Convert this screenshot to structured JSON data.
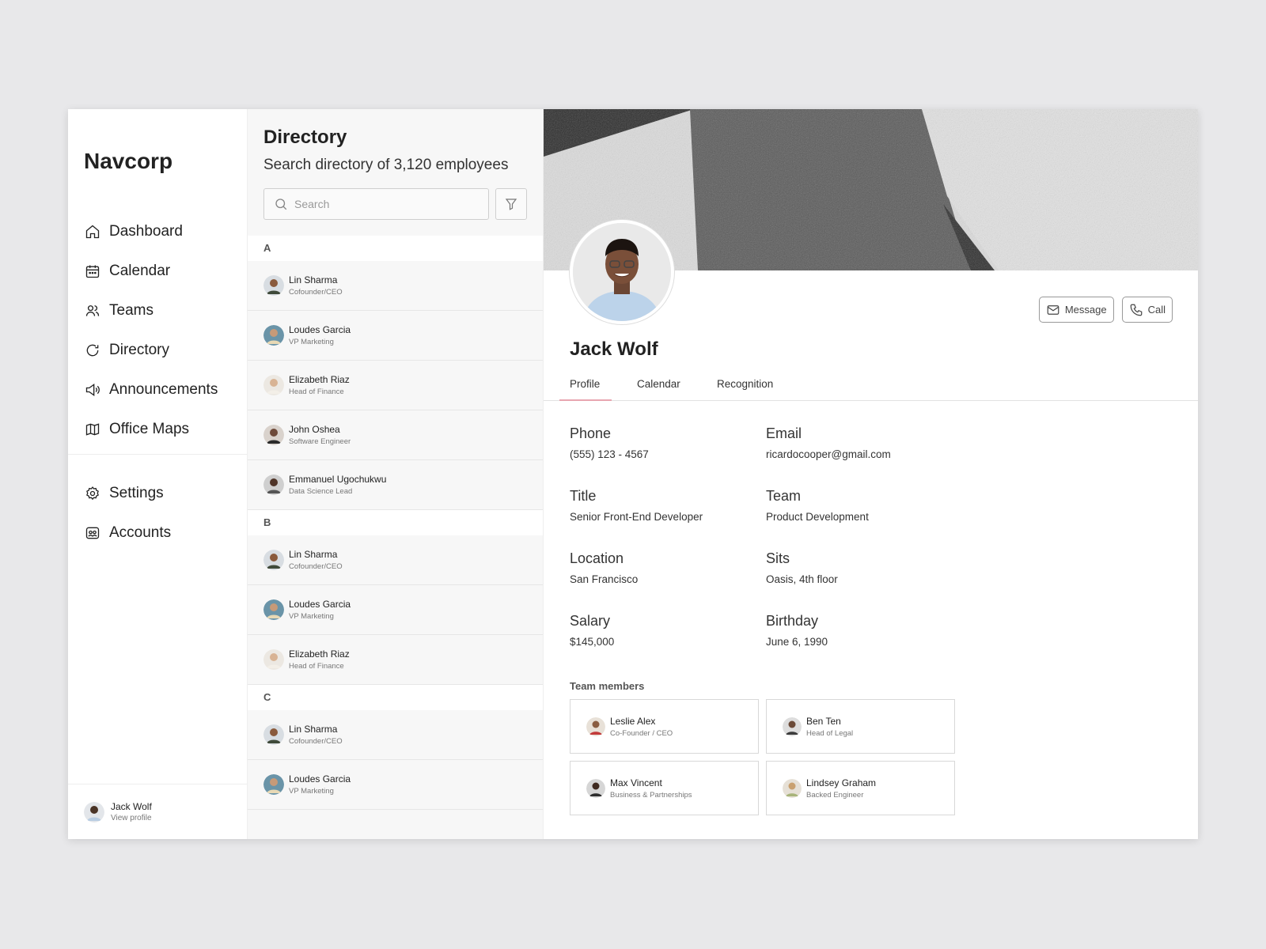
{
  "app": {
    "name": "Navcorp"
  },
  "sidebar": {
    "items": [
      {
        "label": "Dashboard",
        "icon": "home-icon"
      },
      {
        "label": "Calendar",
        "icon": "calendar-icon"
      },
      {
        "label": "Teams",
        "icon": "users-icon"
      },
      {
        "label": "Directory",
        "icon": "directory-icon"
      },
      {
        "label": "Announcements",
        "icon": "megaphone-icon"
      },
      {
        "label": "Office Maps",
        "icon": "map-icon"
      }
    ],
    "secondary": [
      {
        "label": "Settings",
        "icon": "gear-icon"
      },
      {
        "label": "Accounts",
        "icon": "accounts-icon"
      }
    ],
    "user": {
      "name": "Jack Wolf",
      "link": "View profile"
    }
  },
  "directory": {
    "title": "Directory",
    "subtitle": "Search directory of 3,120 employees",
    "search_placeholder": "Search",
    "groups": [
      {
        "letter": "A",
        "people": [
          {
            "name": "Lin Sharma",
            "role": "Cofounder/CEO"
          },
          {
            "name": "Loudes Garcia",
            "role": "VP Marketing"
          },
          {
            "name": "Elizabeth Riaz",
            "role": "Head of Finance"
          },
          {
            "name": "John Oshea",
            "role": "Software Engineer"
          },
          {
            "name": "Emmanuel Ugochukwu",
            "role": "Data Science Lead"
          }
        ]
      },
      {
        "letter": "B",
        "people": [
          {
            "name": "Lin Sharma",
            "role": "Cofounder/CEO"
          },
          {
            "name": "Loudes Garcia",
            "role": "VP Marketing"
          },
          {
            "name": "Elizabeth Riaz",
            "role": "Head of Finance"
          }
        ]
      },
      {
        "letter": "C",
        "people": [
          {
            "name": "Lin Sharma",
            "role": "Cofounder/CEO"
          },
          {
            "name": "Loudes Garcia",
            "role": "VP Marketing"
          }
        ]
      }
    ]
  },
  "profile": {
    "name": "Jack Wolf",
    "actions": {
      "message": "Message",
      "call": "Call"
    },
    "tabs": [
      "Profile",
      "Calendar",
      "Recognition"
    ],
    "active_tab": "Profile",
    "fields": {
      "phone": {
        "label": "Phone",
        "value": "(555) 123 - 4567"
      },
      "email": {
        "label": "Email",
        "value": "ricardocooper@gmail.com"
      },
      "title": {
        "label": "Title",
        "value": "Senior Front-End Developer"
      },
      "team": {
        "label": "Team",
        "value": "Product Development"
      },
      "location": {
        "label": "Location",
        "value": "San Francisco"
      },
      "sits": {
        "label": "Sits",
        "value": "Oasis, 4th floor"
      },
      "salary": {
        "label": "Salary",
        "value": "$145,000"
      },
      "birthday": {
        "label": "Birthday",
        "value": "June 6, 1990"
      }
    },
    "team_members_title": "Team members",
    "team_members": [
      {
        "name": "Leslie Alex",
        "role": "Co-Founder / CEO"
      },
      {
        "name": "Ben Ten",
        "role": "Head of Legal"
      },
      {
        "name": "Max Vincent",
        "role": "Business & Partnerships"
      },
      {
        "name": "Lindsey Graham",
        "role": "Backed Engineer"
      }
    ]
  },
  "colors": {
    "accent_tab": "#e8a6b0",
    "panel_bg": "#f7f7f7",
    "page_bg": "#e8e8ea"
  }
}
